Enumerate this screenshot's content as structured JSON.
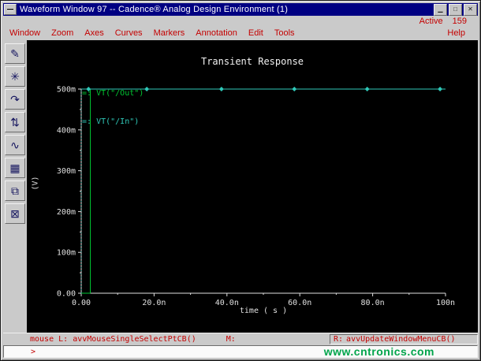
{
  "window": {
    "title": "Waveform Window 97 -- Cadence® Analog Design Environment (1)",
    "controls": {
      "menu": "",
      "minimize": "▁",
      "maximize": "□",
      "close": "✕"
    }
  },
  "header": {
    "active_label": "Active",
    "active_count": "159",
    "help": "Help"
  },
  "menubar": {
    "items": [
      {
        "label": "Window"
      },
      {
        "label": "Zoom"
      },
      {
        "label": "Axes"
      },
      {
        "label": "Curves"
      },
      {
        "label": "Markers"
      },
      {
        "label": "Annotation"
      },
      {
        "label": "Edit"
      },
      {
        "label": "Tools"
      }
    ]
  },
  "toolbar": {
    "buttons": [
      {
        "name": "annotate-tool",
        "glyph": "✎"
      },
      {
        "name": "zoom-tool",
        "glyph": "✳"
      },
      {
        "name": "redraw-tool",
        "glyph": "↷"
      },
      {
        "name": "strip-chart-tool",
        "glyph": "⇅"
      },
      {
        "name": "waveform-tool",
        "glyph": "∿"
      },
      {
        "name": "calculator-tool",
        "glyph": "▦"
      },
      {
        "name": "subwindow-tool",
        "glyph": "⧉"
      },
      {
        "name": "delete-tool",
        "glyph": "⊠"
      }
    ]
  },
  "chart_data": {
    "type": "line",
    "title": "Transient Response",
    "xlabel": "time ( s )",
    "ylabel": "(V)",
    "x_units": "ns",
    "y_units": "mV",
    "xlim": [
      0,
      100
    ],
    "ylim": [
      0,
      500
    ],
    "grid": false,
    "background": "#000000",
    "axis_color": "#e0e0e0",
    "legend_position": "top-left",
    "x_ticks": [
      {
        "v": 0,
        "label": "0.00"
      },
      {
        "v": 20,
        "label": "20.0n"
      },
      {
        "v": 40,
        "label": "40.0n"
      },
      {
        "v": 60,
        "label": "60.0n"
      },
      {
        "v": 80,
        "label": "80.0n"
      },
      {
        "v": 100,
        "label": "100n"
      }
    ],
    "y_ticks": [
      {
        "v": 0,
        "label": "0.00"
      },
      {
        "v": 100,
        "label": "100m"
      },
      {
        "v": 200,
        "label": "200m"
      },
      {
        "v": 300,
        "label": "300m"
      },
      {
        "v": 400,
        "label": "400m"
      },
      {
        "v": 500,
        "label": "500m"
      }
    ],
    "series": [
      {
        "name": "VT(\"/Out\")",
        "symbol": "=:",
        "color": "#00c832",
        "points": [
          [
            0,
            0
          ],
          [
            2.5,
            0
          ],
          [
            2.5,
            500
          ],
          [
            100,
            500
          ]
        ]
      },
      {
        "name": "VT(\"/In\")",
        "symbol": "=:",
        "color": "#2fc9b9",
        "riser_dashed": true,
        "points": [
          [
            0,
            0
          ],
          [
            0,
            500
          ],
          [
            100,
            500
          ]
        ],
        "markers_x": [
          2,
          18,
          38.5,
          58.5,
          78.5,
          98.5
        ],
        "markers_y": 500
      }
    ]
  },
  "statusbar": {
    "mouse_label": "mouse L:",
    "left_binding": "avvMouseSingleSelectPtCB()",
    "middle_label": "M:",
    "right_label": "R:",
    "right_binding": "avvUpdateWindowMenuCB()",
    "prompt": ">"
  },
  "watermark": "www.cntronics.com"
}
